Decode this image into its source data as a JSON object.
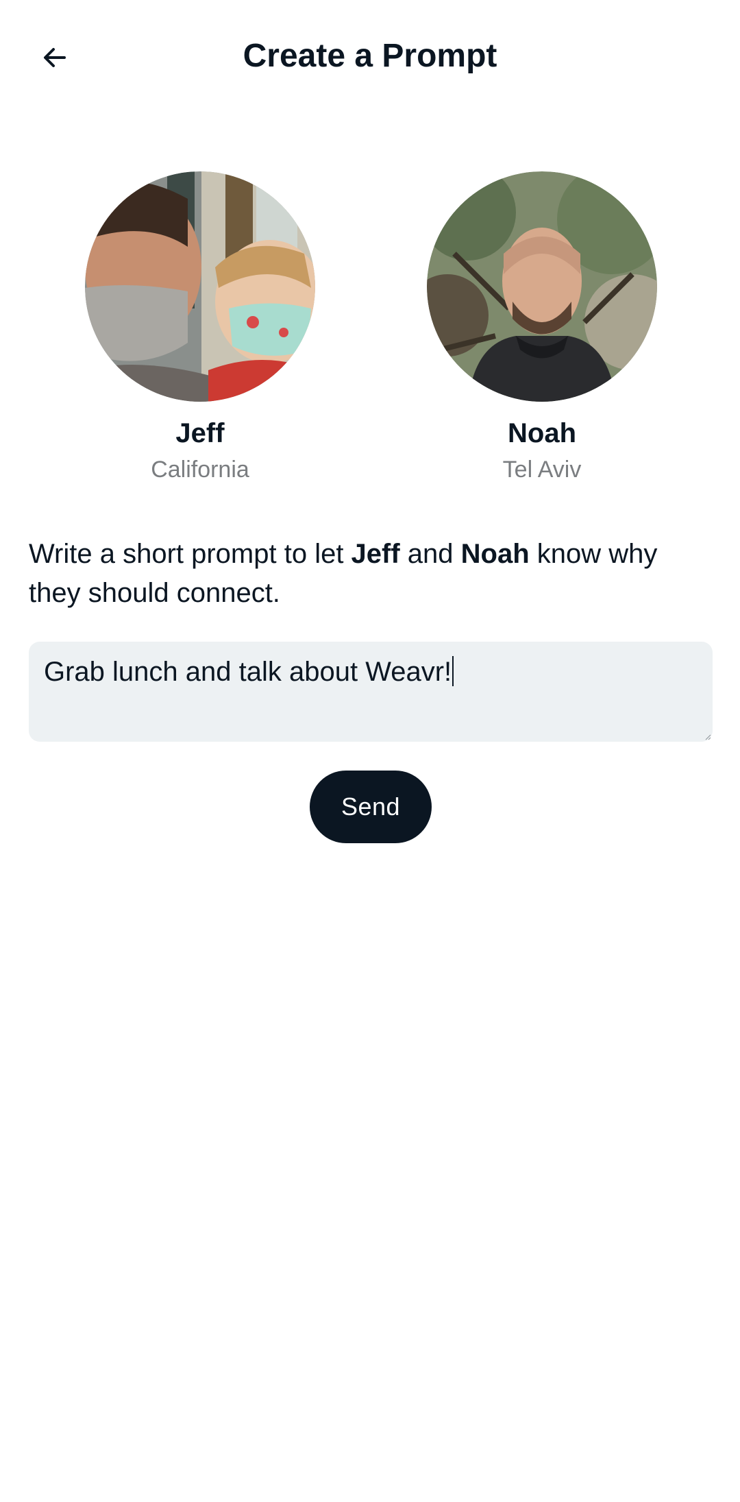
{
  "header": {
    "title": "Create a Prompt",
    "back_icon": "arrow-left-icon"
  },
  "people": [
    {
      "name": "Jeff",
      "location": "California"
    },
    {
      "name": "Noah",
      "location": "Tel Aviv"
    }
  ],
  "instruction": {
    "prefix": "Write a short prompt to let ",
    "name1": "Jeff",
    "middle": " and ",
    "name2": "Noah",
    "suffix": " know why they should connect."
  },
  "prompt": {
    "value": "Grab lunch and talk about Weavr!"
  },
  "send_label": "Send",
  "colors": {
    "primary_dark": "#0b1622",
    "input_bg": "#edf1f3",
    "muted_text": "#7a7d80"
  }
}
